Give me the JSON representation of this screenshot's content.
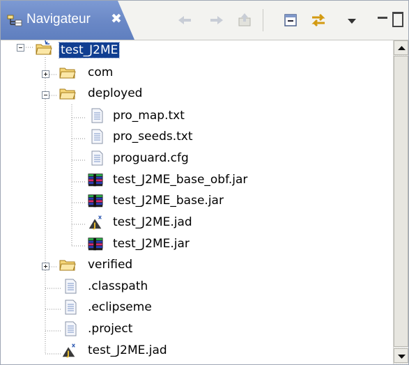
{
  "view": {
    "title": "Navigateur",
    "close_glyph": "✖",
    "toolbar": [
      {
        "name": "back-icon"
      },
      {
        "name": "forward-icon"
      },
      {
        "name": "up-folder-icon"
      },
      {
        "name": "collapse-all-icon"
      },
      {
        "name": "link-with-editor-icon"
      },
      {
        "name": "view-menu-icon"
      },
      {
        "name": "minimize-icon"
      },
      {
        "name": "maximize-icon"
      }
    ]
  },
  "tree": [
    {
      "label": "test_J2ME",
      "icon": "project-folder-icon",
      "state": "expanded",
      "selected": true
    },
    {
      "label": "com",
      "icon": "folder-icon",
      "state": "collapsed"
    },
    {
      "label": "deployed",
      "icon": "folder-icon",
      "state": "expanded"
    },
    {
      "label": "pro_map.txt",
      "icon": "text-file-icon"
    },
    {
      "label": "pro_seeds.txt",
      "icon": "text-file-icon"
    },
    {
      "label": "proguard.cfg",
      "icon": "text-file-icon"
    },
    {
      "label": "test_J2ME_base_obf.jar",
      "icon": "jar-file-icon"
    },
    {
      "label": "test_J2ME_base.jar",
      "icon": "jar-file-icon"
    },
    {
      "label": "test_J2ME.jad",
      "icon": "jad-file-icon"
    },
    {
      "label": "test_J2ME.jar",
      "icon": "jar-file-icon"
    },
    {
      "label": "verified",
      "icon": "folder-icon",
      "state": "collapsed"
    },
    {
      "label": ".classpath",
      "icon": "text-file-icon"
    },
    {
      "label": ".eclipseme",
      "icon": "text-file-icon"
    },
    {
      "label": ".project",
      "icon": "text-file-icon"
    },
    {
      "label": "test_J2ME.jad",
      "icon": "jad-file-icon"
    }
  ],
  "scrollbar": {
    "up": "scroll-up-arrow",
    "down": "scroll-down-arrow"
  }
}
